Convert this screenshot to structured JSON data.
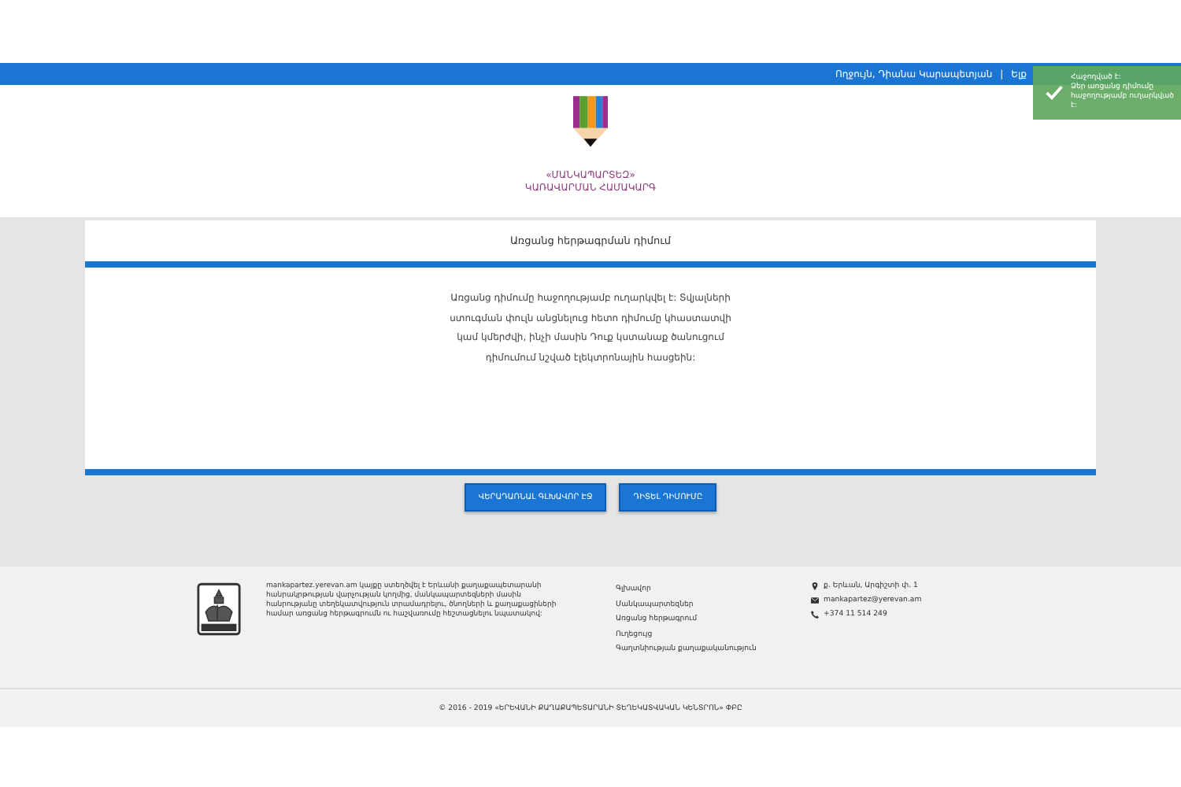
{
  "top_bar": {
    "greeting": "Ողջույն, Դիանա Կարապետյան",
    "separator": "|",
    "logout": "Ելք"
  },
  "notification": {
    "title": "Հաջողված է:",
    "message": "Ձեր առցանց դիմումը հաջողությամբ ուղարկված է:"
  },
  "logo": {
    "lines": [
      "«ՄԱՆԿԱՊԱՐՏԵԶ»",
      "ԿԱՌԱՎԱՐՄԱՆ ՀԱՄԱԿԱՐԳ"
    ]
  },
  "card": {
    "title": "Առցանց հերթագրման դիմում",
    "message": "Առցանց դիմումը հաջողությամբ ուղարկվել է: Տվյալների ստուգման փուլն անցնելուց հետո դիմումը կհաստատվի կամ կմերժվի, ինչի մասին Դուք կստանաք ծանուցում դիմումում նշված էլեկտրոնային հասցեին:"
  },
  "buttons": [
    "ՎԵՐԱԴԱՌՆԱԼ ԳԼԽԱՎՈՐ ԷՋ",
    "ԴԻՏԵԼ ԴԻՄՈՒՄԸ"
  ],
  "footer": {
    "about": "mankapartez.yerevan.am կայքը ստեղծվել է Երևանի քաղաքապետարանի հանրակրթության վարչության կողմից, մանկապարտեզների մասին հանրությանը տեղեկատվություն տրամադրելու, ծնողների և քաղաքացիների համար առցանց հերթագրումն ու հաշվառումը հեշտացնելու նպատակով:",
    "links": [
      "Գլխավոր",
      "Մանկապարտեզներ",
      "Առցանց հերթագրում",
      "Ուղեցույց",
      "Գաղտնիության քաղաքականություն"
    ],
    "contacts": [
      {
        "kind": "address",
        "text": "ք. Երևան, Արգիշտի փ. 1"
      },
      {
        "kind": "email",
        "text": "mankapartez@yerevan.am"
      },
      {
        "kind": "phone",
        "text": "+374 11 514 249"
      }
    ],
    "copyright": "© 2016 - 2019 «ԵՐԵՎԱՆԻ ՔԱՂԱՔԱՊԵՏԱՐԱՆԻ ՏԵՂԵԿԱՏՎԱԿԱՆ ԿԵՆՏՐՈՆ» ՓԲԸ"
  }
}
